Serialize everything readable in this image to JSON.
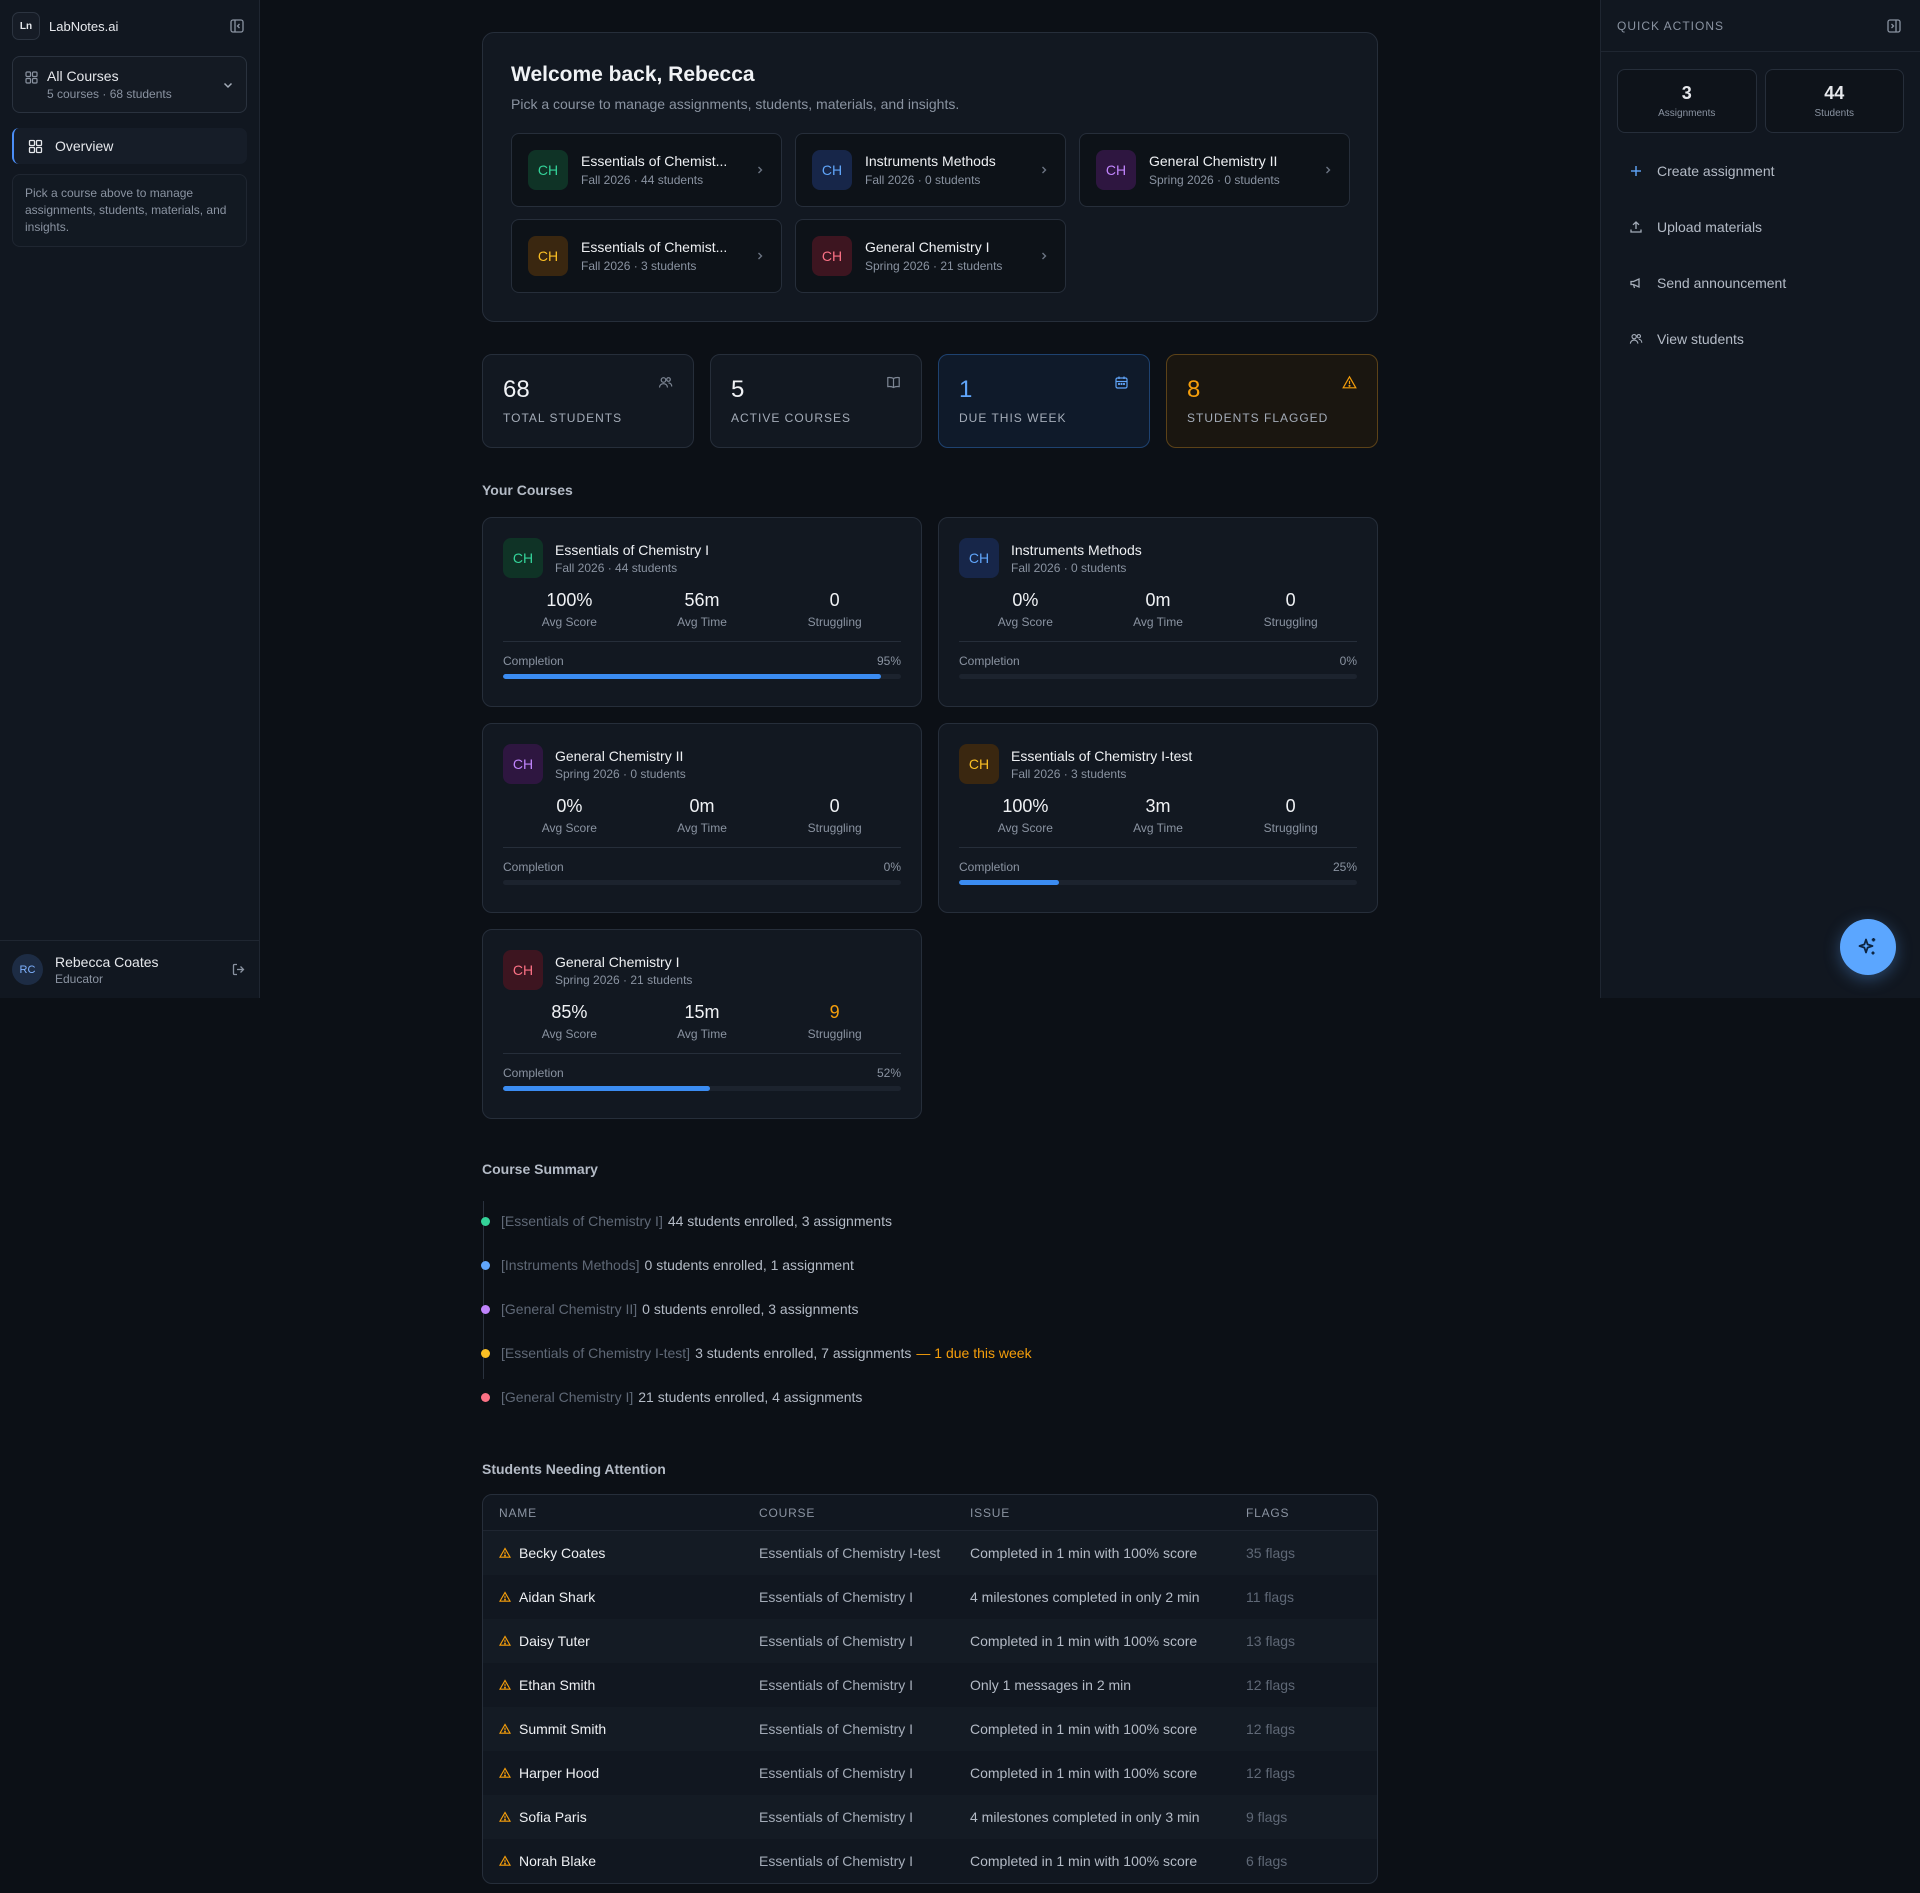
{
  "app": {
    "logo": "Ln",
    "name": "LabNotes.ai"
  },
  "sidebar": {
    "course_select": {
      "title": "All Courses",
      "subtitle": "5 courses · 68 students"
    },
    "nav": [
      {
        "label": "Overview",
        "icon": "grid-icon"
      }
    ],
    "hint": "Pick a course above to manage assignments, students, materials, and insights.",
    "user": {
      "initials": "RC",
      "name": "Rebecca Coates",
      "role": "Educator"
    }
  },
  "welcome": {
    "title": "Welcome back, Rebecca",
    "subtitle": "Pick a course to manage assignments, students, materials, and insights.",
    "courses": [
      {
        "badge": "CH",
        "title": "Essentials of Chemist...",
        "subtitle": "Fall 2026 · 44 students",
        "color": "#34d399"
      },
      {
        "badge": "CH",
        "title": "Instruments Methods",
        "subtitle": "Fall 2026 · 0 students",
        "color": "#60a5fa"
      },
      {
        "badge": "CH",
        "title": "General Chemistry II",
        "subtitle": "Spring 2026 · 0 students",
        "color": "#c084fc"
      },
      {
        "badge": "CH",
        "title": "Essentials of Chemist...",
        "subtitle": "Fall 2026 · 3 students",
        "color": "#fbbf24"
      },
      {
        "badge": "CH",
        "title": "General Chemistry I",
        "subtitle": "Spring 2026 · 21 students",
        "color": "#fb7185"
      }
    ]
  },
  "stats": [
    {
      "value": "68",
      "label": "TOTAL STUDENTS",
      "icon": "users-icon"
    },
    {
      "value": "5",
      "label": "ACTIVE COURSES",
      "icon": "book-icon"
    },
    {
      "value": "1",
      "label": "DUE THIS WEEK",
      "icon": "calendar-icon",
      "color": "#60a5fa"
    },
    {
      "value": "8",
      "label": "STUDENTS FLAGGED",
      "icon": "warning-icon",
      "color": "#f59e0b"
    }
  ],
  "your_courses": {
    "title": "Your Courses",
    "labels": {
      "avg_score": "Avg Score",
      "avg_time": "Avg Time",
      "struggling": "Struggling",
      "completion": "Completion"
    },
    "cards": [
      {
        "badge": "CH",
        "title": "Essentials of Chemistry I",
        "subtitle": "Fall 2026 · 44 students",
        "avg_score": "100%",
        "avg_time": "56m",
        "struggling": "0",
        "completion_label": "95%",
        "completion": 0.95
      },
      {
        "badge": "CH",
        "title": "Instruments Methods",
        "subtitle": "Fall 2026 · 0 students",
        "avg_score": "0%",
        "avg_time": "0m",
        "struggling": "0",
        "completion_label": "0%",
        "completion": 0
      },
      {
        "badge": "CH",
        "title": "General Chemistry II",
        "subtitle": "Spring 2026 · 0 students",
        "avg_score": "0%",
        "avg_time": "0m",
        "struggling": "0",
        "completion_label": "0%",
        "completion": 0
      },
      {
        "badge": "CH",
        "title": "Essentials of Chemistry I-test",
        "subtitle": "Fall 2026 · 3 students",
        "avg_score": "100%",
        "avg_time": "3m",
        "struggling": "0",
        "completion_label": "25%",
        "completion": 0.25
      },
      {
        "badge": "CH",
        "title": "General Chemistry I",
        "subtitle": "Spring 2026 · 21 students",
        "avg_score": "85%",
        "avg_time": "15m",
        "struggling": "9",
        "completion_label": "52%",
        "completion": 0.52
      }
    ]
  },
  "course_summary": {
    "title": "Course Summary",
    "items": [
      {
        "tag": "[Essentials of Chemistry I]",
        "text": "44 students enrolled, 3 assignments",
        "due": "",
        "color": "#34d399"
      },
      {
        "tag": "[Instruments Methods]",
        "text": "0 students enrolled, 1 assignment",
        "due": "",
        "color": "#60a5fa"
      },
      {
        "tag": "[General Chemistry II]",
        "text": "0 students enrolled, 3 assignments",
        "due": "",
        "color": "#c084fc"
      },
      {
        "tag": "[Essentials of Chemistry I-test]",
        "text": "3 students enrolled, 7 assignments",
        "due": "— 1 due this week",
        "color": "#fbbf24"
      },
      {
        "tag": "[General Chemistry I]",
        "text": "21 students enrolled, 4 assignments",
        "due": "",
        "color": "#fb7185"
      }
    ]
  },
  "attention": {
    "title": "Students Needing Attention",
    "columns": [
      "NAME",
      "COURSE",
      "ISSUE",
      "FLAGS"
    ],
    "rows": [
      {
        "name": "Becky Coates",
        "course": "Essentials of Chemistry I-test",
        "issue": "Completed in 1 min with 100% score",
        "flags": "35 flags"
      },
      {
        "name": "Aidan Shark",
        "course": "Essentials of Chemistry I",
        "issue": "4 milestones completed in only 2 min",
        "flags": "11 flags"
      },
      {
        "name": "Daisy Tuter",
        "course": "Essentials of Chemistry I",
        "issue": "Completed in 1 min with 100% score",
        "flags": "13 flags"
      },
      {
        "name": "Ethan Smith",
        "course": "Essentials of Chemistry I",
        "issue": "Only 1 messages in 2 min",
        "flags": "12 flags"
      },
      {
        "name": "Summit Smith",
        "course": "Essentials of Chemistry I",
        "issue": "Completed in 1 min with 100% score",
        "flags": "12 flags"
      },
      {
        "name": "Harper Hood",
        "course": "Essentials of Chemistry I",
        "issue": "Completed in 1 min with 100% score",
        "flags": "12 flags"
      },
      {
        "name": "Sofia Paris",
        "course": "Essentials of Chemistry I",
        "issue": "4 milestones completed in only 3 min",
        "flags": "9 flags"
      },
      {
        "name": "Norah Blake",
        "course": "Essentials of Chemistry I",
        "issue": "Completed in 1 min with 100% score",
        "flags": "6 flags"
      }
    ]
  },
  "quick_actions": {
    "title": "QUICK ACTIONS",
    "stats": [
      {
        "value": "3",
        "label": "Assignments"
      },
      {
        "value": "44",
        "label": "Students"
      }
    ],
    "actions": [
      {
        "label": "Create assignment",
        "icon": "plus-icon"
      },
      {
        "label": "Upload materials",
        "icon": "upload-icon"
      },
      {
        "label": "Send announcement",
        "icon": "megaphone-icon"
      },
      {
        "label": "View students",
        "icon": "users-icon"
      }
    ]
  },
  "colors": {
    "accent": "#3b8cf2",
    "warning": "#f59e0b",
    "background": "#0c1016"
  }
}
